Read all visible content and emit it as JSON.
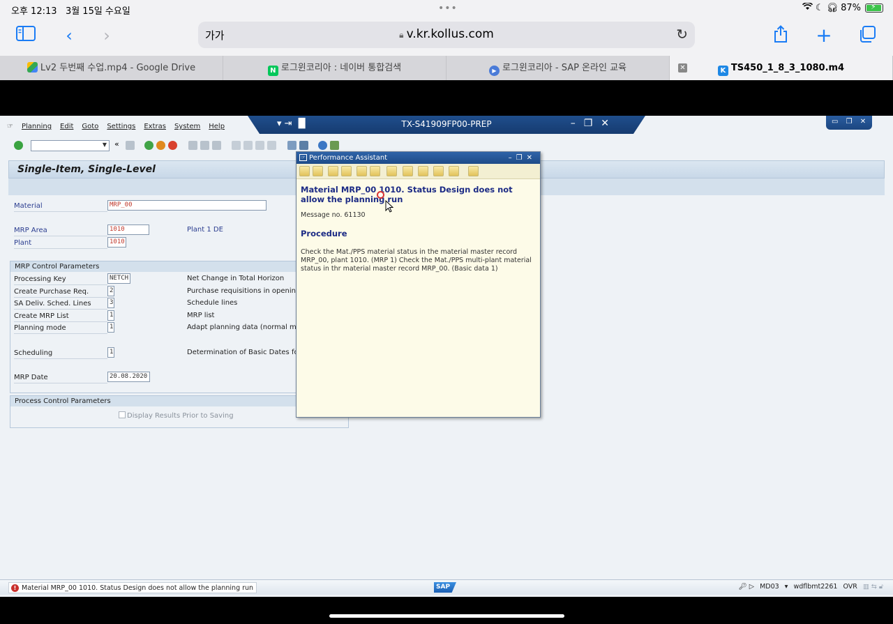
{
  "ios": {
    "time": "오후 12:13",
    "date": "3월 15일 수요일",
    "dots": "•••",
    "battery": "87%"
  },
  "safari": {
    "text_size": "가가",
    "url": "v.kr.kollus.com",
    "tabs": [
      {
        "label": "Lv2 두번째 수업.mp4 - Google Drive"
      },
      {
        "label": "로그윈코리아 : 네이버 통합검색"
      },
      {
        "label": "로그윈코리아 - SAP 온라인 교육"
      },
      {
        "label": "TS450_1_8_3_1080.m4"
      }
    ],
    "icons": [
      "sidebar-icon",
      "back-icon",
      "forward-icon",
      "share-icon",
      "plus-icon",
      "tabs-icon"
    ]
  },
  "sap": {
    "system_title": "TX-S41909FP00-PREP",
    "menu": [
      "Planning",
      "Edit",
      "Goto",
      "Settings",
      "Extras",
      "System",
      "Help"
    ],
    "page_title": "Single-Item, Single-Level",
    "fields": {
      "material": {
        "label": "Material",
        "value": "MRP_00"
      },
      "mrp_area": {
        "label": "MRP Area",
        "value": "1010",
        "desc": "Plant 1 DE"
      },
      "plant": {
        "label": "Plant",
        "value": "1010"
      }
    },
    "mrp_control": {
      "title": "MRP Control Parameters",
      "rows": [
        {
          "label": "Processing Key",
          "value": "NETCH",
          "desc": "Net Change in Total Horizon"
        },
        {
          "label": "Create Purchase Req.",
          "value": "2",
          "desc": "Purchase requisitions in opening pe"
        },
        {
          "label": "SA Deliv. Sched. Lines",
          "value": "3",
          "desc": "Schedule lines"
        },
        {
          "label": "Create MRP List",
          "value": "1",
          "desc": "MRP list"
        },
        {
          "label": "Planning mode",
          "value": "1",
          "desc": "Adapt planning data (normal mode)"
        },
        {
          "label": "Scheduling",
          "value": "1",
          "desc": "Determination of Basic Dates for Pla"
        },
        {
          "label": "MRP Date",
          "value": "20.08.2020",
          "desc": ""
        }
      ]
    },
    "process_control": {
      "title": "Process Control Parameters",
      "checkbox": "Display Results Prior to Saving"
    },
    "status": {
      "message": "Material MRP_00 1010. Status Design does not allow the planning run",
      "logo": "SAP",
      "transaction": "MD03",
      "server": "wdflbmt2261",
      "mode": "OVR"
    }
  },
  "assistant": {
    "title": "Performance Assistant",
    "heading": "Material MRP_00 1010. Status Design does not allow the planning run",
    "message_no": "Message no. 61130",
    "procedure_title": "Procedure",
    "procedure_text": "Check the Mat./PPS material status in the material master record MRP_00, plant 1010. (MRP 1) Check the Mat./PPS multi-plant material status in thr material master record MRP_00. (Basic data 1)"
  }
}
